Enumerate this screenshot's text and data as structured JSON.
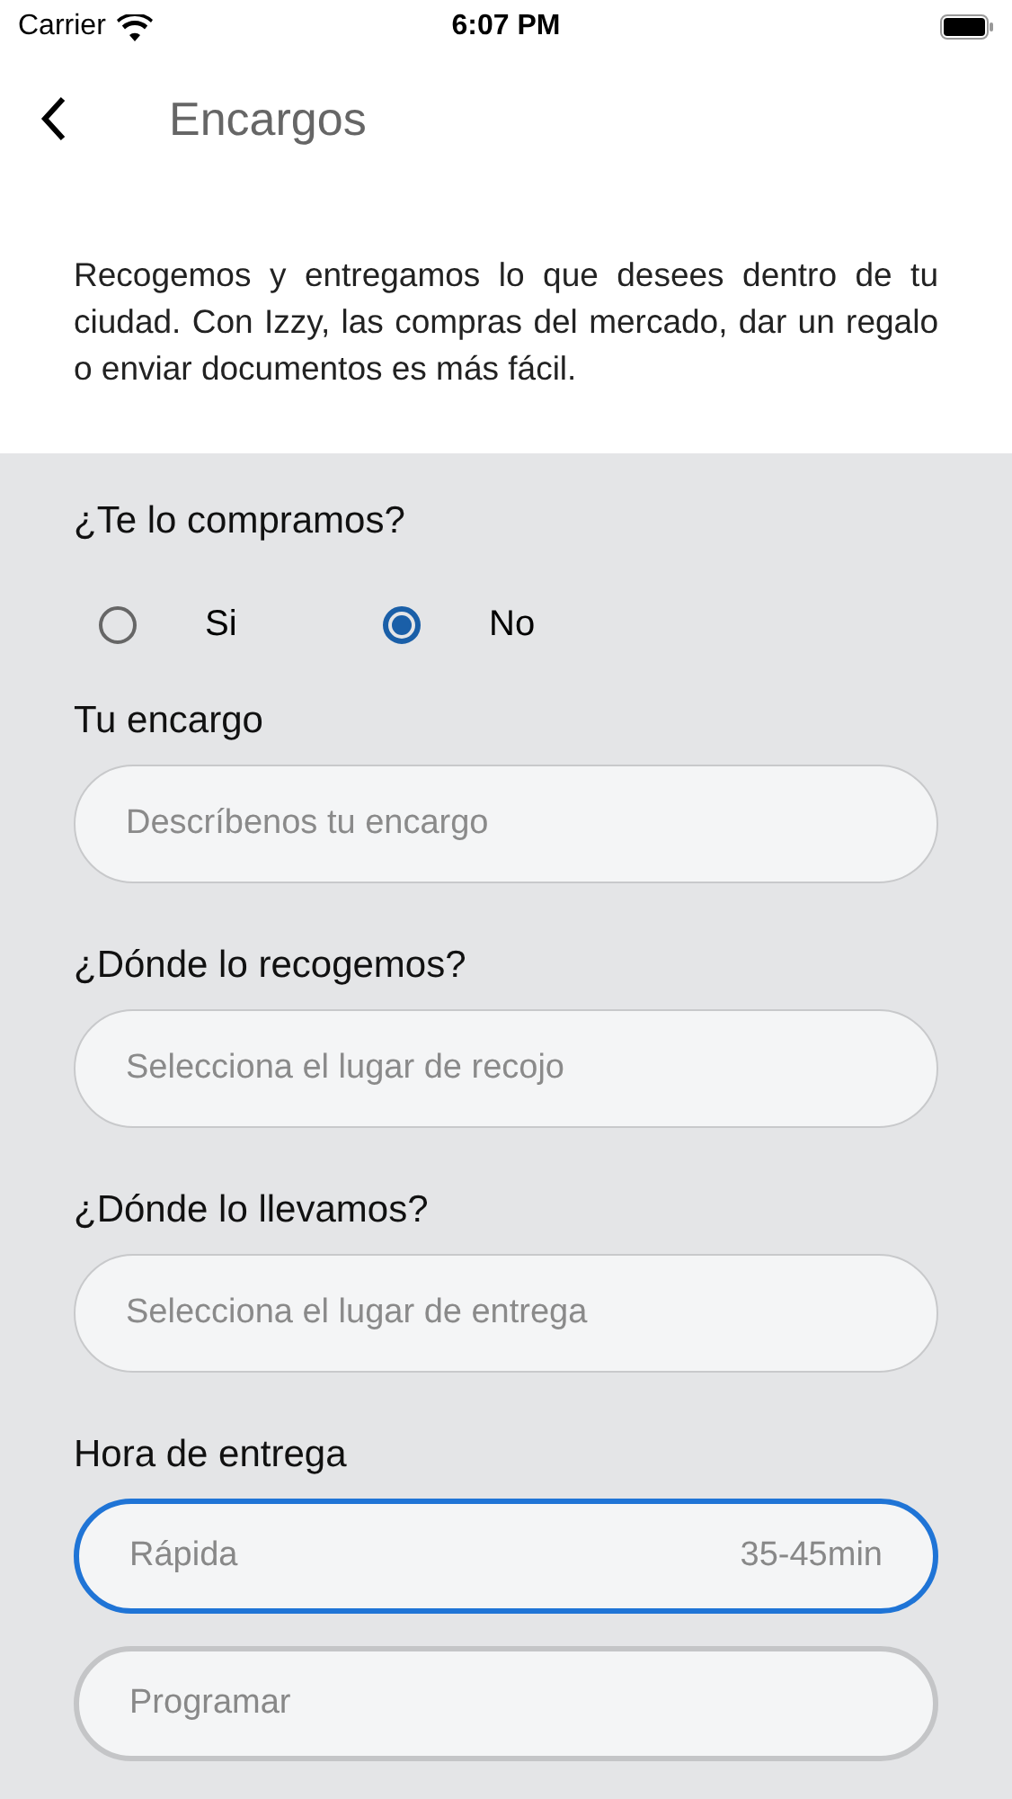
{
  "status_bar": {
    "carrier": "Carrier",
    "time": "6:07 PM"
  },
  "header": {
    "title": "Encargos"
  },
  "intro": "Recogemos y entregamos lo que desees dentro de tu ciudad. Con Izzy, las compras del mercado, dar un regalo o enviar documentos es más fácil.",
  "buy_question": {
    "label": "¿Te lo compramos?",
    "options": [
      {
        "label": "Si",
        "selected": false
      },
      {
        "label": "No",
        "selected": true
      }
    ]
  },
  "fields": [
    {
      "label": "Tu encargo",
      "placeholder": "Descríbenos tu encargo"
    },
    {
      "label": "¿Dónde lo recogemos?",
      "placeholder": "Selecciona el lugar de recojo"
    },
    {
      "label": "¿Dónde lo llevamos?",
      "placeholder": "Selecciona el lugar de entrega"
    }
  ],
  "delivery": {
    "label": "Hora de entrega",
    "options": [
      {
        "label": "Rápida",
        "time": "35-45min",
        "selected": true
      },
      {
        "label": "Programar",
        "selected": false
      }
    ]
  }
}
